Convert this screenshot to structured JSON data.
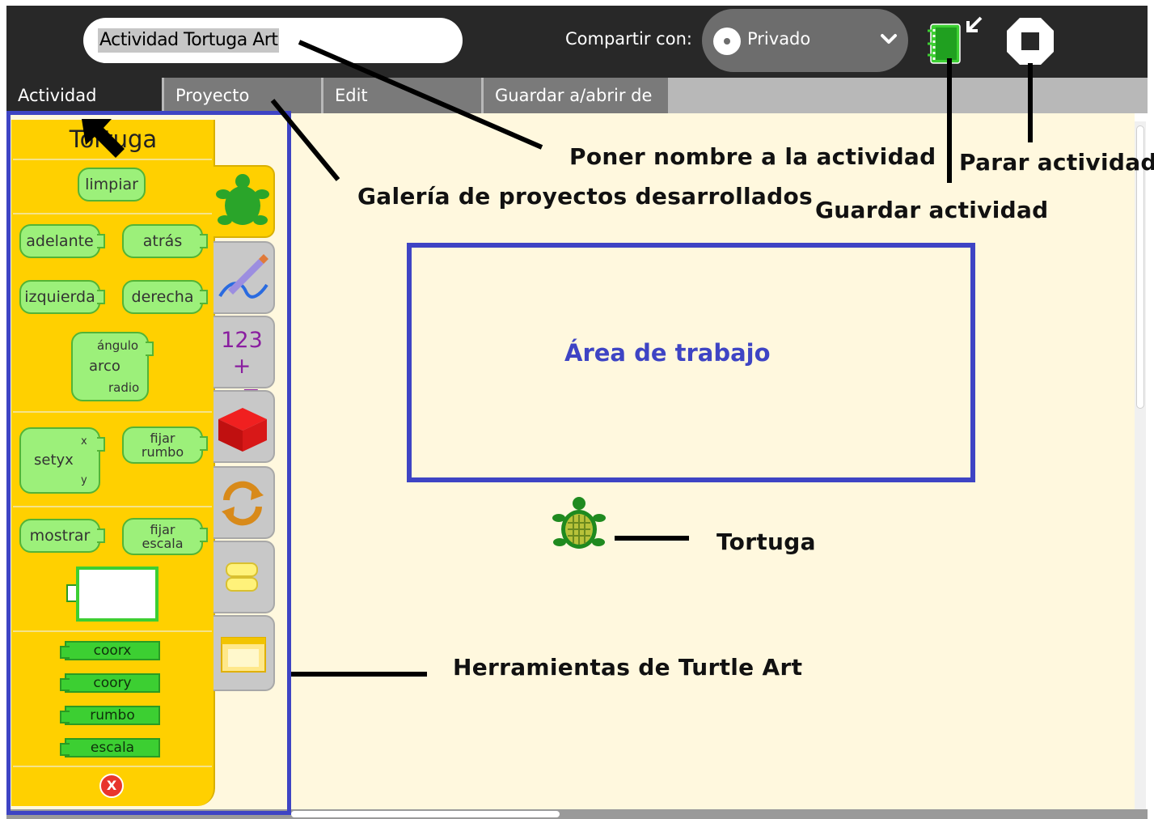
{
  "toolbar": {
    "activity_title": "Actividad Tortuga Art",
    "share_label": "Compartir con:",
    "share_value": "Privado",
    "keep_icon": "journal-keep-icon",
    "stop_icon": "stop-icon"
  },
  "tabs": [
    {
      "label": "Actividad"
    },
    {
      "label": "Proyecto"
    },
    {
      "label": "Edit"
    },
    {
      "label": "Guardar a/abrir de"
    }
  ],
  "palette": {
    "title": "Tortuga",
    "blocks": {
      "limpiar": "limpiar",
      "adelante": "adelante",
      "atras": "atrás",
      "izquierda": "izquierda",
      "derecha": "derecha",
      "angulo": "ángulo",
      "arco": "arco",
      "radio": "radio",
      "setyx": "setyx",
      "setyx_x": "x",
      "setyx_y": "y",
      "fijar_rumbo_1": "fijar",
      "fijar_rumbo_2": "rumbo",
      "mostrar": "mostrar",
      "fijar_escala_1": "fijar",
      "fijar_escala_2": "escala",
      "coorx": "coorx",
      "coory": "coory",
      "rumbo": "rumbo",
      "escala": "escala"
    },
    "close_glyph": "X",
    "categories": [
      "tortuga",
      "pluma",
      "numeros",
      "flujo",
      "bloques",
      "extras",
      "medios"
    ],
    "numeros_label_1": "123",
    "numeros_label_2": "+−="
  },
  "annotations": {
    "nombre": "Poner nombre a la actividad",
    "galeria": "Galería de proyectos desarrollados",
    "guardar": "Guardar actividad",
    "parar": "Parar actividad",
    "area": "Área de trabajo",
    "tortuga": "Tortuga",
    "herramientas": "Herramientas de Turtle Art"
  },
  "colors": {
    "toolbar_bg": "#282828",
    "canvas_bg": "#fff8de",
    "palette_bg": "#ffd000",
    "annotation_frame": "#3e44c4",
    "block_green": "#9cf07a"
  }
}
